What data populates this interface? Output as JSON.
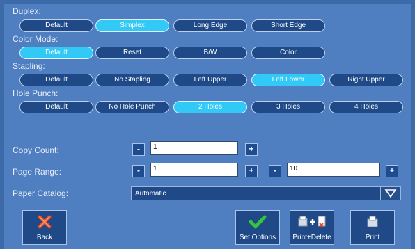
{
  "duplex": {
    "label": "Duplex:",
    "options": [
      "Default",
      "Simplex",
      "Long Edge",
      "Short Edge"
    ],
    "selected": "Simplex"
  },
  "color_mode": {
    "label": "Color Mode:",
    "options": [
      "Default",
      "Reset",
      "B/W",
      "Color"
    ],
    "selected": "Default"
  },
  "stapling": {
    "label": "Stapling:",
    "options": [
      "Default",
      "No Stapling",
      "Left Upper",
      "Left Lower",
      "Right Upper"
    ],
    "selected": "Left Lower"
  },
  "hole_punch": {
    "label": "Hole Punch:",
    "options": [
      "Default",
      "No Hole Punch",
      "2 Holes",
      "3 Holes",
      "4 Holes"
    ],
    "selected": "2 Holes"
  },
  "copy_count": {
    "label": "Copy Count:",
    "value": "1",
    "minus": "-",
    "plus": "+"
  },
  "page_range": {
    "label": "Page Range:",
    "from": "1",
    "to": "10",
    "minus": "-",
    "plus": "+"
  },
  "paper_catalog": {
    "label": "Paper Catalog:",
    "value": "Automatic"
  },
  "actions": {
    "back": "Back",
    "set_options": "Set Options",
    "print_delete": "Print+Delete",
    "print": "Print"
  },
  "colors": {
    "background": "#4f7fc0",
    "pill": "#1f4a87",
    "pill_active": "#33c9f6",
    "check": "#35c43b",
    "back_x": "#e24a2a"
  }
}
